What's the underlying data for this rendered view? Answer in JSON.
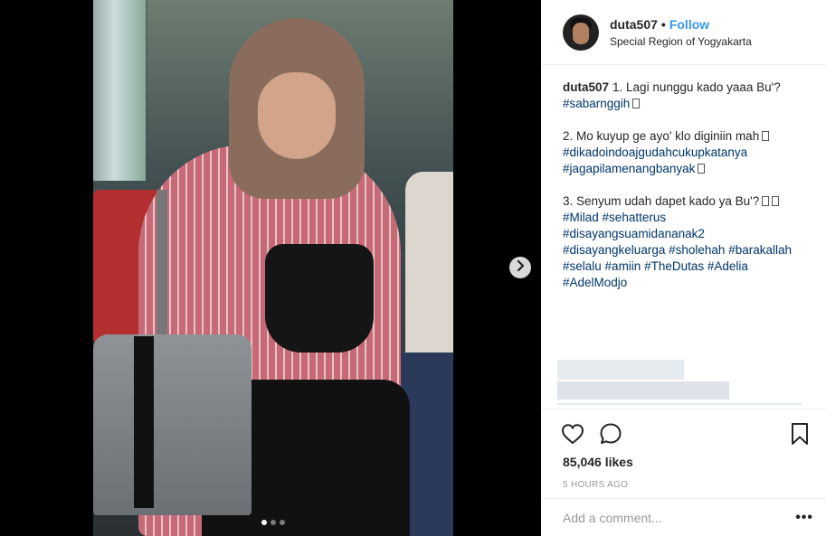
{
  "post": {
    "username": "duta507",
    "separator": "•",
    "follow_label": "Follow",
    "location": "Special Region of Yogyakarta",
    "caption": {
      "p1_text": "1. Lagi nunggu kado yaaa Bu'?",
      "p1_tags": [
        "#sabarnggih"
      ],
      "p2_text": "2. Mo kuyup ge ayo' klo diginiin mah",
      "p2_tags": [
        "#dikadoindoajgudahcukupkatanya",
        "#jagapilamenangbanyak"
      ],
      "p3_text": "3. Senyum udah dapet kado ya Bu'?",
      "p3_tags": [
        "#Milad",
        "#sehatterus",
        "#disayangsuamidananak2",
        "#disayangkeluarga",
        "#sholehah",
        "#barakallah",
        "#selalu",
        "#amiin",
        "#TheDutas",
        "#Adelia",
        "#AdelModjo"
      ]
    },
    "likes": "85,046 likes",
    "time_ago": "5 HOURS AGO",
    "comment_placeholder": "Add a comment...",
    "more_label": "•••",
    "carousel": {
      "count": 3,
      "active": 1
    }
  },
  "icons": {
    "like": "heart-icon",
    "comment": "comment-icon",
    "save": "bookmark-icon",
    "next": "chevron-right-icon"
  }
}
